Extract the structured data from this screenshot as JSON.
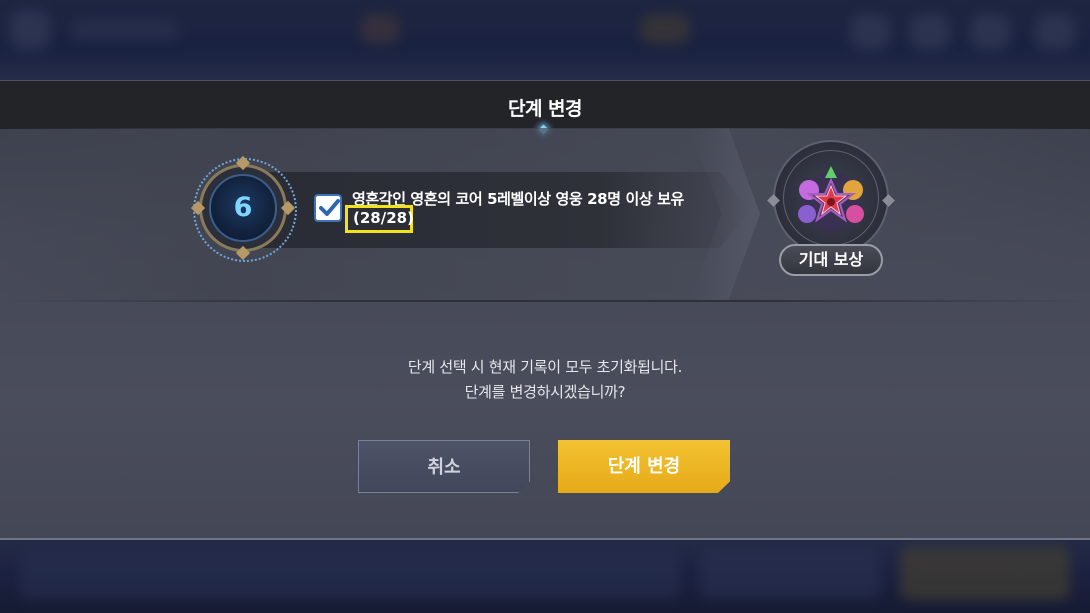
{
  "dialog": {
    "title": "단계 변경"
  },
  "condition": {
    "level": "6",
    "checked": true,
    "text": "영혼각인 영혼의 코어 5레벨이상 영웅 28명 이상 보유",
    "count": "(28/28)"
  },
  "reward": {
    "label": "기대 보상"
  },
  "message": {
    "line1": "단계 선택 시 현재 기록이 모두 초기화됩니다.",
    "line2": "단계를 변경하시겠습니까?"
  },
  "buttons": {
    "cancel": "취소",
    "confirm": "단계 변경"
  },
  "colors": {
    "confirm_button": "#f0ba2a",
    "highlight_box": "#f2e21a",
    "level_number": "#7fd6ff"
  }
}
